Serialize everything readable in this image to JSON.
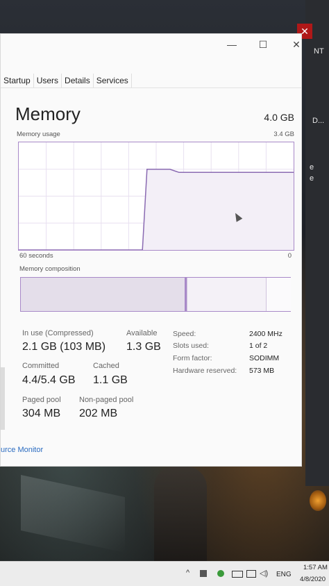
{
  "window": {
    "controls": {
      "minimize": "—",
      "maximize": "☐",
      "close": "✕"
    },
    "tabs": [
      "Startup",
      "Users",
      "Details",
      "Services"
    ]
  },
  "memory": {
    "title": "Memory",
    "total": "4.0 GB",
    "usage_label": "Memory usage",
    "usage_max": "3.4 GB",
    "time_left": "60 seconds",
    "time_right": "0",
    "composition_label": "Memory composition"
  },
  "usage_graph": {
    "type": "area",
    "points": [
      {
        "t": 60,
        "v": 0
      },
      {
        "t": 33,
        "v": 0
      },
      {
        "t": 32,
        "v": 2.55
      },
      {
        "t": 27,
        "v": 2.55
      },
      {
        "t": 25,
        "v": 2.45
      },
      {
        "t": 0,
        "v": 2.45
      }
    ],
    "ylim": [
      0,
      3.4
    ],
    "xlim": [
      60,
      0
    ],
    "colors": {
      "line": "#8a6ab2",
      "fill": "#f3eff7",
      "grid": "#e8e0f0"
    }
  },
  "stats": {
    "in_use_label": "In use (Compressed)",
    "in_use_value": "2.1 GB (103 MB)",
    "available_label": "Available",
    "available_value": "1.3 GB",
    "committed_label": "Committed",
    "committed_value": "4.4/5.4 GB",
    "cached_label": "Cached",
    "cached_value": "1.1 GB",
    "paged_label": "Paged pool",
    "paged_value": "304 MB",
    "nonpaged_label": "Non-paged pool",
    "nonpaged_value": "202 MB"
  },
  "details": {
    "speed_label": "Speed:",
    "speed_value": "2400 MHz",
    "slots_label": "Slots used:",
    "slots_value": "1 of 2",
    "form_label": "Form factor:",
    "form_value": "SODIMM",
    "hw_label": "Hardware reserved:",
    "hw_value": "573 MB"
  },
  "footer": {
    "resource_monitor": "urce Monitor"
  },
  "side": {
    "nt": "NT",
    "d": "D...",
    "e1": "e",
    "e2": "e"
  },
  "taskbar": {
    "chevron": "^",
    "lang": "ENG",
    "time": "1:57 AM",
    "date": "4/8/2020"
  },
  "colors": {
    "accent": "#8a6ab2",
    "link": "#2a6bc0"
  }
}
